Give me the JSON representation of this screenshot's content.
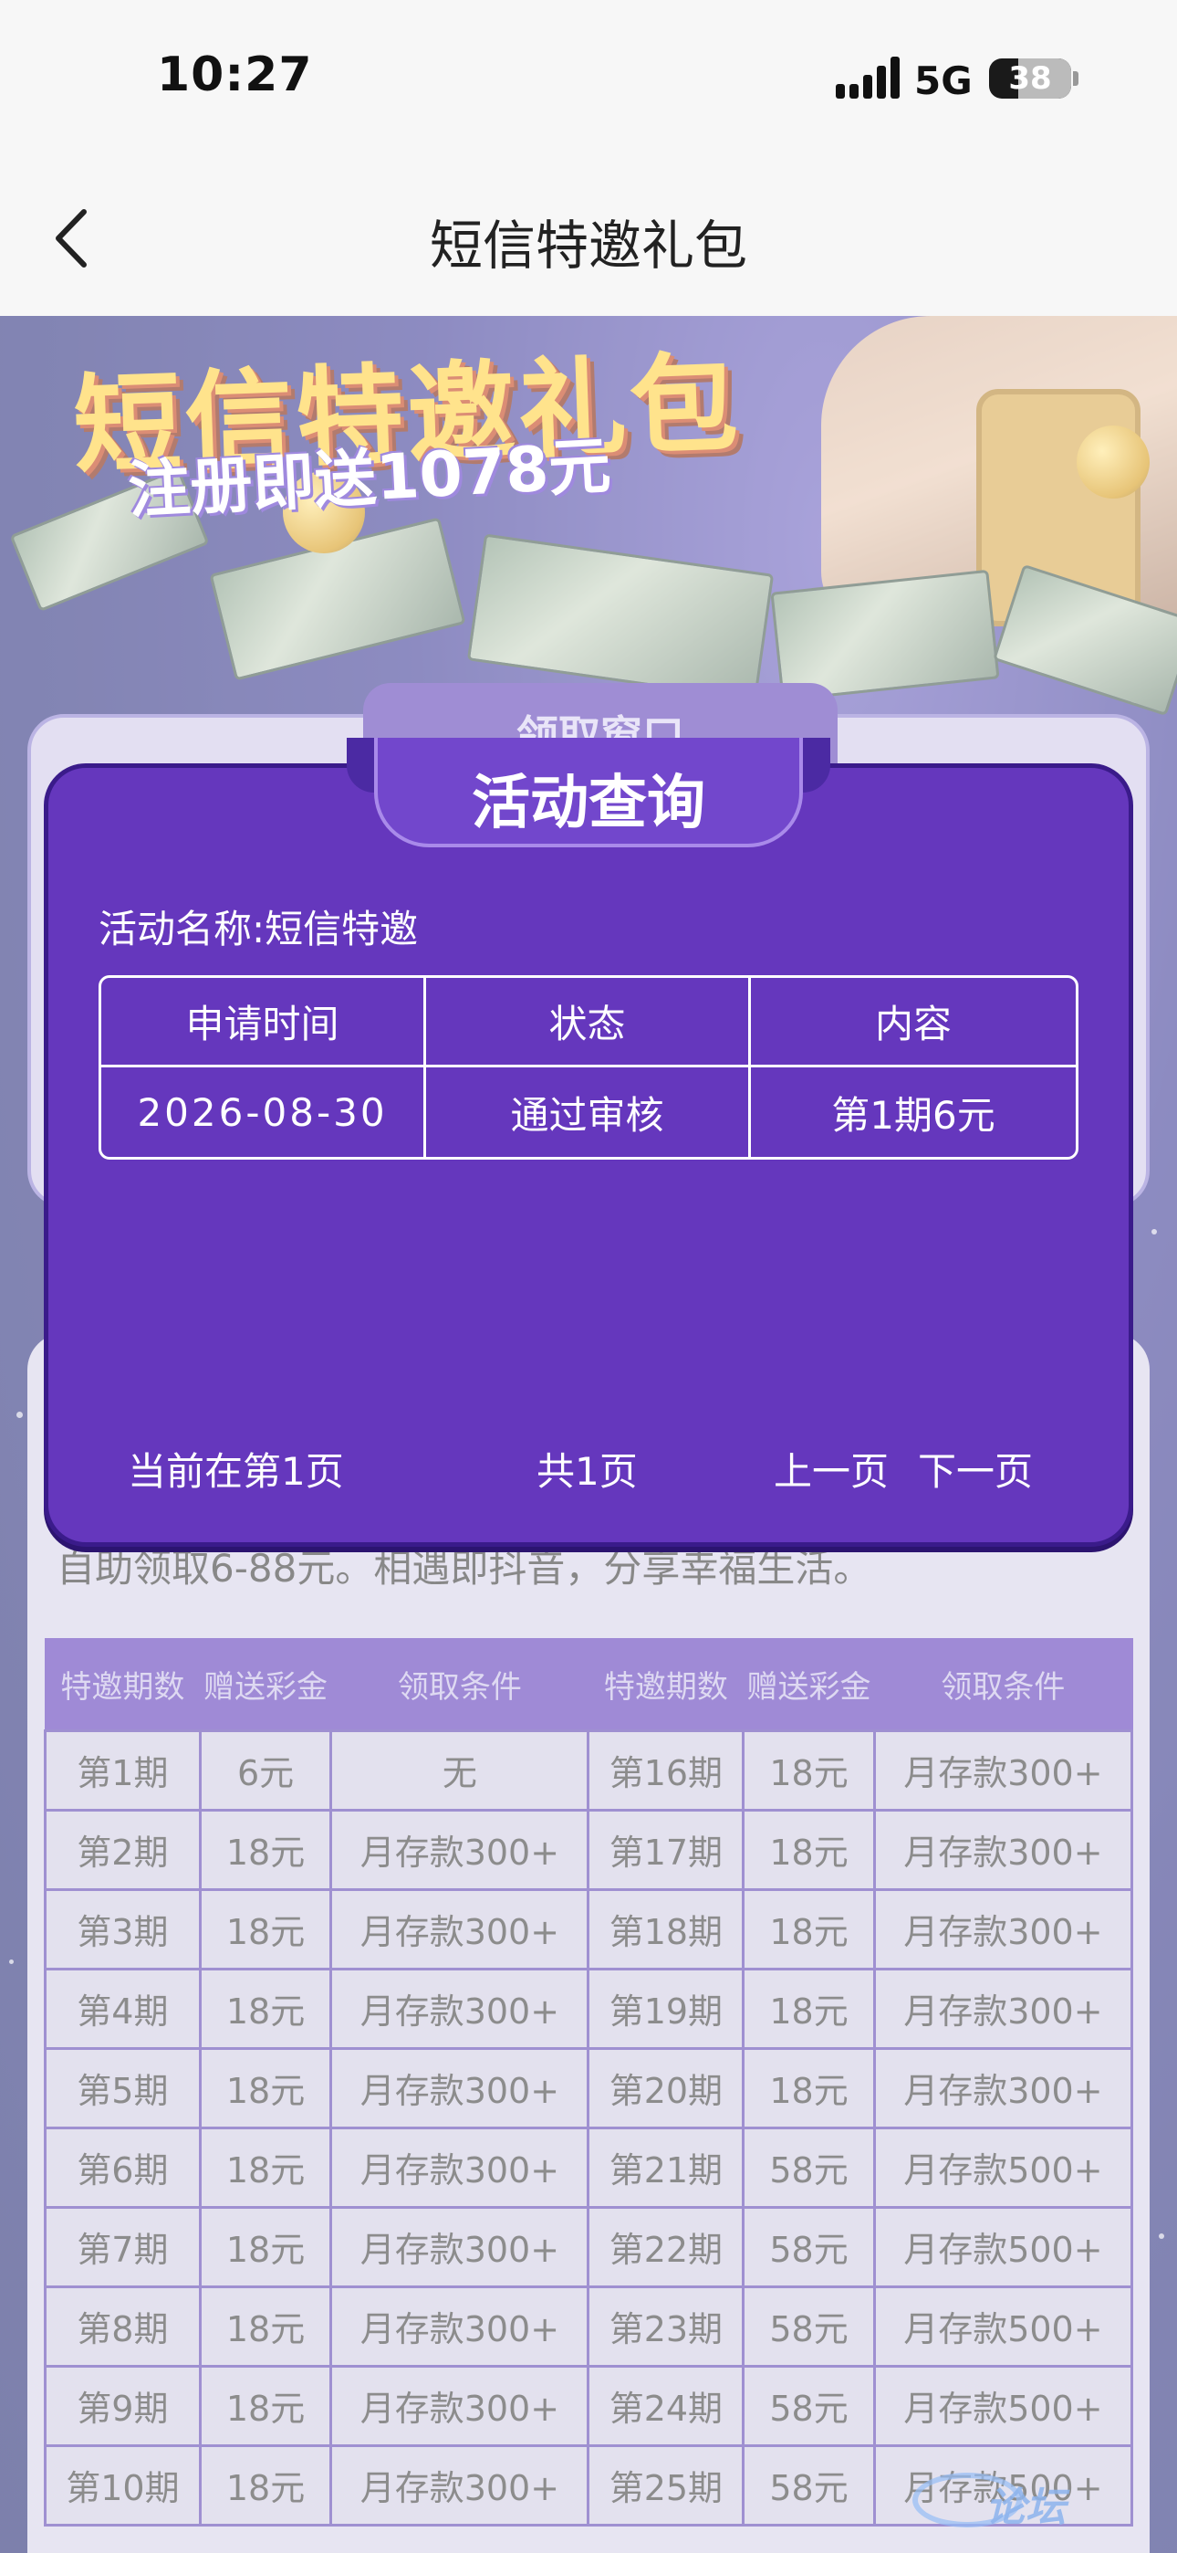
{
  "status_bar": {
    "time": "10:27",
    "network": "5G",
    "battery": "38"
  },
  "nav": {
    "title": "短信特邀礼包",
    "back_icon": "chevron-left-icon"
  },
  "banner": {
    "title": "短信特邀礼包",
    "subtitle": "注册即送1078元"
  },
  "window": {
    "tab_label": "领取窗口"
  },
  "intro": {
    "text": "自助领取6-88元。相遇即抖音，分享幸福生活。"
  },
  "rules_table": {
    "headers": [
      "特邀期数",
      "赠送彩金",
      "领取条件",
      "特邀期数",
      "赠送彩金",
      "领取条件"
    ],
    "rows": [
      [
        "第1期",
        "6元",
        "无",
        "第16期",
        "18元",
        "月存款300+"
      ],
      [
        "第2期",
        "18元",
        "月存款300+",
        "第17期",
        "18元",
        "月存款300+"
      ],
      [
        "第3期",
        "18元",
        "月存款300+",
        "第18期",
        "18元",
        "月存款300+"
      ],
      [
        "第4期",
        "18元",
        "月存款300+",
        "第19期",
        "18元",
        "月存款300+"
      ],
      [
        "第5期",
        "18元",
        "月存款300+",
        "第20期",
        "18元",
        "月存款300+"
      ],
      [
        "第6期",
        "18元",
        "月存款300+",
        "第21期",
        "58元",
        "月存款500+"
      ],
      [
        "第7期",
        "18元",
        "月存款300+",
        "第22期",
        "58元",
        "月存款500+"
      ],
      [
        "第8期",
        "18元",
        "月存款300+",
        "第23期",
        "58元",
        "月存款500+"
      ],
      [
        "第9期",
        "18元",
        "月存款300+",
        "第24期",
        "58元",
        "月存款500+"
      ],
      [
        "第10期",
        "18元",
        "月存款300+",
        "第25期",
        "58元",
        "月存款500+"
      ]
    ]
  },
  "modal": {
    "title": "活动查询",
    "activity_name": "活动名称:短信特邀",
    "table": {
      "headers": [
        "申请时间",
        "状态",
        "内容"
      ],
      "rows": [
        [
          "2026-08-30",
          "通过审核",
          "第1期6元"
        ]
      ]
    },
    "pager": {
      "current": "当前在第1页",
      "total": "共1页",
      "prev": "上一页",
      "next": "下一页"
    }
  },
  "colors": {
    "modal_bg": "#6537bd",
    "table_header": "#5b36b8",
    "accent_gold": "#ffcf3a"
  }
}
